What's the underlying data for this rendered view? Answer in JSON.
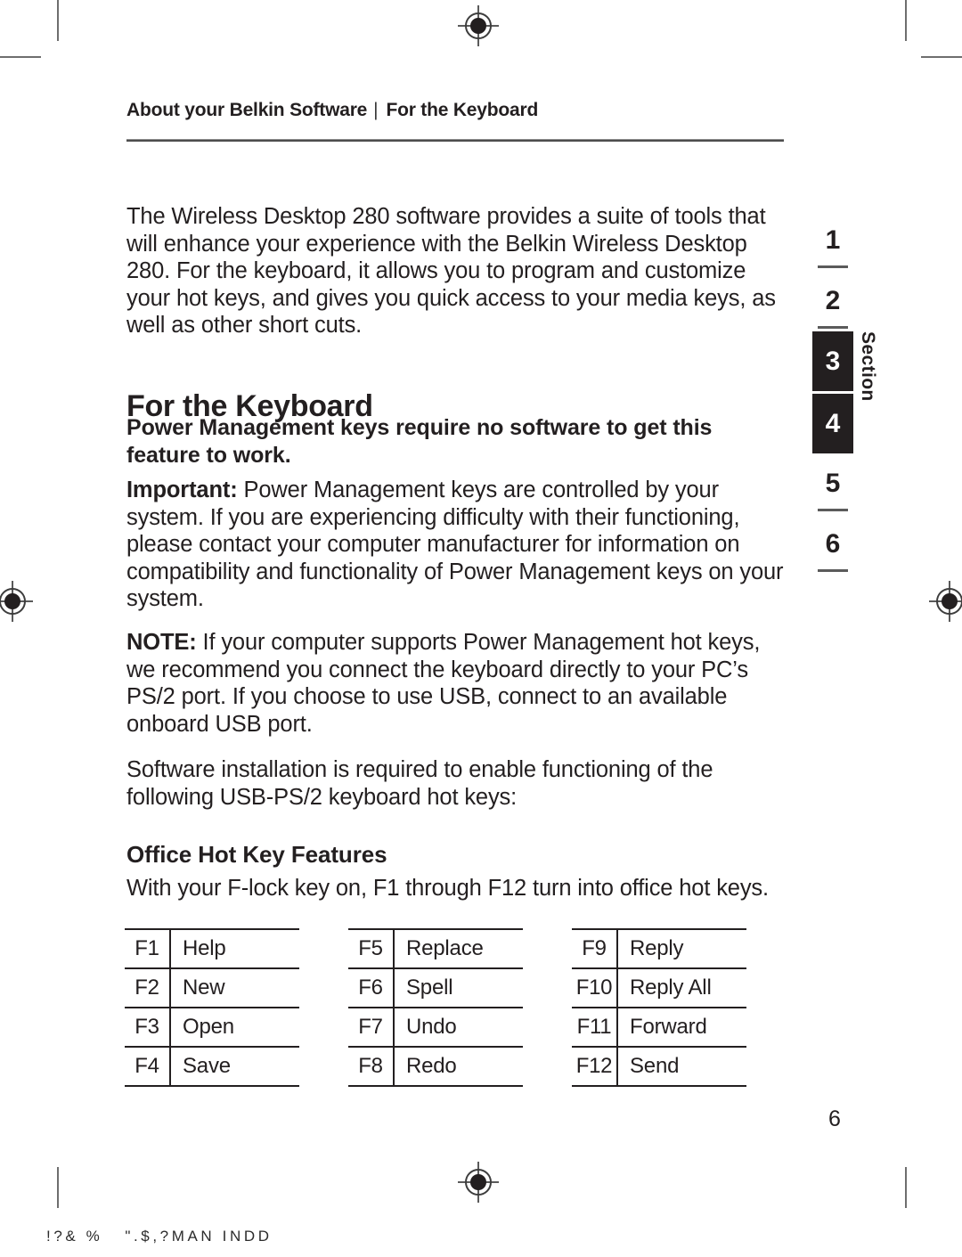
{
  "running_head": {
    "left": "About your Belkin Software",
    "separator": "|",
    "right": "For the Keyboard"
  },
  "intro_paragraph": "The Wireless Desktop 280 software provides a suite of tools that will enhance your experience with the Belkin Wireless Desktop 280. For the keyboard, it allows you to program and customize your hot keys, and gives you quick access to your media keys, as well as other short cuts.",
  "section_heading": "For the Keyboard",
  "power_note": "Power Management keys require no software to get this feature to work.",
  "important": {
    "label": "Important:",
    "text": " Power Management keys are controlled by your system. If you are experiencing difficulty with their functioning, please contact your computer manufacturer for information on compatibility and functionality of Power Management keys on your system."
  },
  "note": {
    "label": "NOTE:",
    "text": " If your computer supports Power Management hot keys, we recommend you connect the keyboard directly to your PC’s PS/2 port. If you choose to use USB, connect to an available onboard USB port."
  },
  "install_paragraph": "Software installation is required to enable functioning of the following USB-PS/2 keyboard hot keys:",
  "office_heading": "Office Hot Key Features",
  "office_intro": "With your F-lock key on, F1 through F12 turn into office hot keys.",
  "key_tables": [
    {
      "rows": [
        {
          "key": "F1",
          "fn": "Help"
        },
        {
          "key": "F2",
          "fn": "New"
        },
        {
          "key": "F3",
          "fn": "Open"
        },
        {
          "key": "F4",
          "fn": "Save"
        }
      ]
    },
    {
      "rows": [
        {
          "key": "F5",
          "fn": "Replace"
        },
        {
          "key": "F6",
          "fn": "Spell"
        },
        {
          "key": "F7",
          "fn": "Undo"
        },
        {
          "key": "F8",
          "fn": "Redo"
        }
      ]
    },
    {
      "rows": [
        {
          "key": "F9",
          "fn": "Reply"
        },
        {
          "key": "F10",
          "fn": "Reply All"
        },
        {
          "key": "F11",
          "fn": "Forward"
        },
        {
          "key": "F12",
          "fn": "Send"
        }
      ]
    }
  ],
  "section_index": {
    "label": "Section",
    "tabs": [
      {
        "number": "1",
        "active": false
      },
      {
        "number": "2",
        "active": false
      },
      {
        "number": "3",
        "active": true
      },
      {
        "number": "4",
        "active": true
      },
      {
        "number": "5",
        "active": false
      },
      {
        "number": "6",
        "active": false
      }
    ]
  },
  "page_number": "6",
  "footer_slug": "!?& %   \".$,?MAN INDD",
  "colors": {
    "ink": "#231f20",
    "rule": "#4d4d4d",
    "crop_mark": "#6e6e6e",
    "tab_active_bg": "#231f20",
    "tab_active_text": "#ffffff"
  }
}
